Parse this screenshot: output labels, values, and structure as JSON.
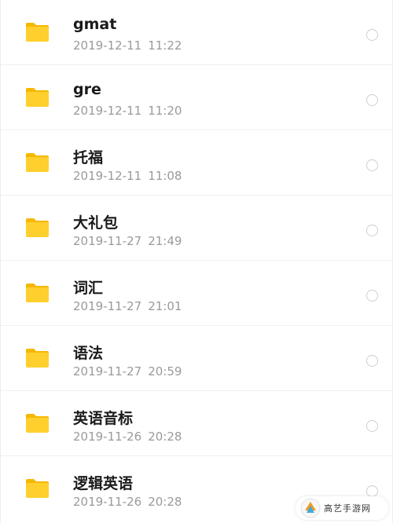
{
  "colors": {
    "folder": "#FFCF2E",
    "folder_tab": "#F5B800",
    "title": "#1a1a1a",
    "meta": "#9a9a9a"
  },
  "icons": {
    "item": "folder-icon",
    "select": "radio-circle-icon"
  },
  "files": [
    {
      "name": "gmat",
      "date": "2019-12-11",
      "time": "11:22"
    },
    {
      "name": "gre",
      "date": "2019-12-11",
      "time": "11:20"
    },
    {
      "name": "托福",
      "date": "2019-12-11",
      "time": "11:08"
    },
    {
      "name": "大礼包",
      "date": "2019-11-27",
      "time": "21:49"
    },
    {
      "name": "词汇",
      "date": "2019-11-27",
      "time": "21:01"
    },
    {
      "name": "语法",
      "date": "2019-11-27",
      "time": "20:59"
    },
    {
      "name": "英语音标",
      "date": "2019-11-26",
      "time": "20:28"
    },
    {
      "name": "逻辑英语",
      "date": "2019-11-26",
      "time": "20:28"
    }
  ],
  "watermark": {
    "text": "高艺手游网"
  }
}
